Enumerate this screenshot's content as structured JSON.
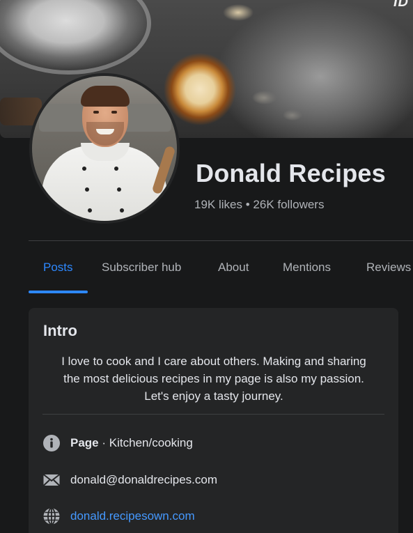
{
  "cover": {
    "watermark": "ID"
  },
  "profile": {
    "name": "Donald Recipes",
    "likes": "19K likes",
    "separator": "•",
    "followers": "26K followers"
  },
  "tabs": [
    {
      "label": "Posts",
      "active": true
    },
    {
      "label": "Subscriber hub",
      "active": false
    },
    {
      "label": "About",
      "active": false
    },
    {
      "label": "Mentions",
      "active": false
    },
    {
      "label": "Reviews",
      "active": false
    }
  ],
  "intro": {
    "title": "Intro",
    "bio_lines": [
      "I love to cook and I care about others. Making and sharing",
      "the most delicious recipes in my page is also my passion.",
      "Let's enjoy a tasty journey."
    ],
    "category_label": "Page",
    "category_separator": "·",
    "category_value": "Kitchen/cooking",
    "email": "donald@donaldrecipes.com",
    "website": "donald.recipesown.com"
  },
  "icons": {
    "info": "info-icon",
    "email": "envelope-icon",
    "website": "globe-icon"
  },
  "colors": {
    "background": "#18191a",
    "card": "#242526",
    "accent": "#2d88ff",
    "link": "#4599ff",
    "text_primary": "#e4e6eb",
    "text_secondary": "#b0b3b8"
  }
}
